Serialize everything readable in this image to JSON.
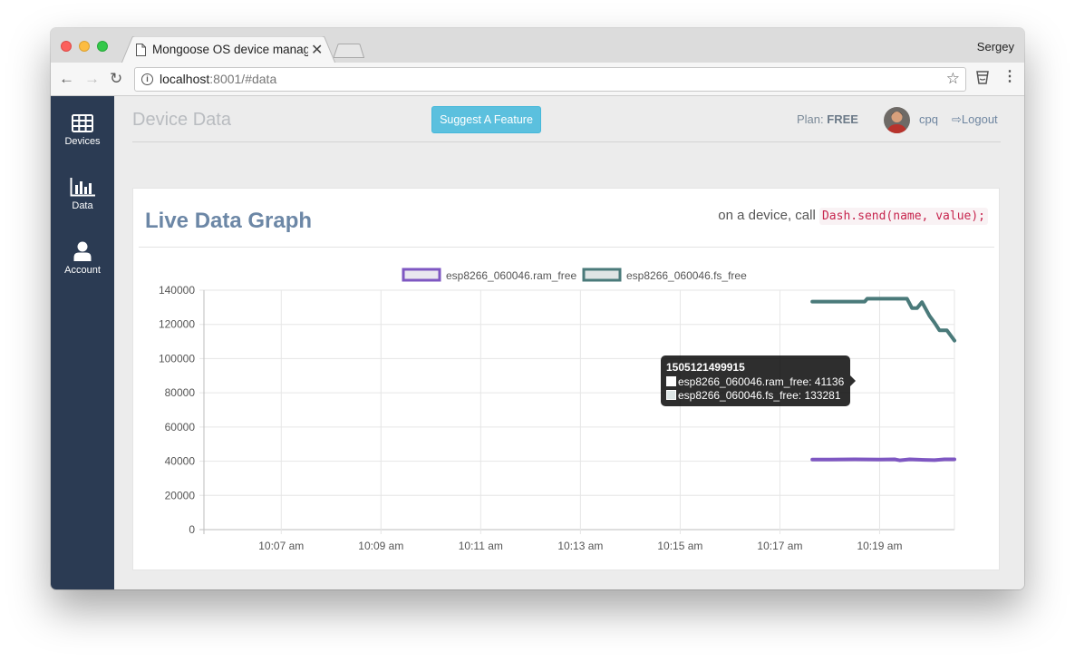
{
  "browser": {
    "tab_title": "Mongoose OS device management",
    "profile_name": "Sergey",
    "url_host": "localhost",
    "url_rest": ":8001/#data"
  },
  "sidebar": {
    "items": [
      {
        "label": "Devices",
        "icon": "table-icon"
      },
      {
        "label": "Data",
        "icon": "bar-chart-icon"
      },
      {
        "label": "Account",
        "icon": "user-icon"
      }
    ]
  },
  "header": {
    "title": "Device Data",
    "suggest_button": "Suggest A Feature",
    "plan_label": "Plan:",
    "plan_value": "FREE",
    "username": "cpq",
    "logout": "Logout"
  },
  "panel": {
    "title": "Live Data Graph",
    "hint_text": "on a device, call",
    "hint_code": "Dash.send(name, value);"
  },
  "tooltip": {
    "title": "1505121499915",
    "rows": [
      {
        "text": "esp8266_060046.ram_free: 41136",
        "color": "#7e57c2"
      },
      {
        "text": "esp8266_060046.fs_free: 133281",
        "color": "#4a7a7a"
      }
    ]
  },
  "chart_data": {
    "type": "line",
    "title": "",
    "xlabel": "",
    "ylabel": "",
    "ylim": [
      0,
      140000
    ],
    "y_ticks": [
      0,
      20000,
      40000,
      60000,
      80000,
      100000,
      120000,
      140000
    ],
    "x_ticks": [
      "10:07 am",
      "10:09 am",
      "10:11 am",
      "10:13 am",
      "10:15 am",
      "10:17 am",
      "10:19 am"
    ],
    "x_tick_minutes": [
      7,
      9,
      11,
      13,
      15,
      17,
      19
    ],
    "xlim_minutes": [
      5.45,
      20.5
    ],
    "grid": true,
    "legend_position": "top",
    "series": [
      {
        "name": "esp8266_060046.ram_free",
        "color": "#7e57c2",
        "x_minutes": [
          17.65,
          18.0,
          18.5,
          19.0,
          19.3,
          19.4,
          19.6,
          19.9,
          20.1,
          20.3,
          20.5
        ],
        "values": [
          41000,
          41000,
          41100,
          41000,
          41100,
          40500,
          41100,
          40800,
          40600,
          41100,
          41100
        ]
      },
      {
        "name": "esp8266_060046.fs_free",
        "color": "#4a7a7a",
        "x_minutes": [
          17.65,
          18.0,
          18.5,
          18.7,
          18.75,
          19.0,
          19.3,
          19.55,
          19.65,
          19.75,
          19.85,
          20.0,
          20.1,
          20.2,
          20.35,
          20.5
        ],
        "values": [
          133300,
          133300,
          133300,
          133300,
          135000,
          135000,
          135000,
          135000,
          129500,
          129500,
          133000,
          125000,
          121000,
          116500,
          116500,
          110500
        ]
      }
    ]
  }
}
